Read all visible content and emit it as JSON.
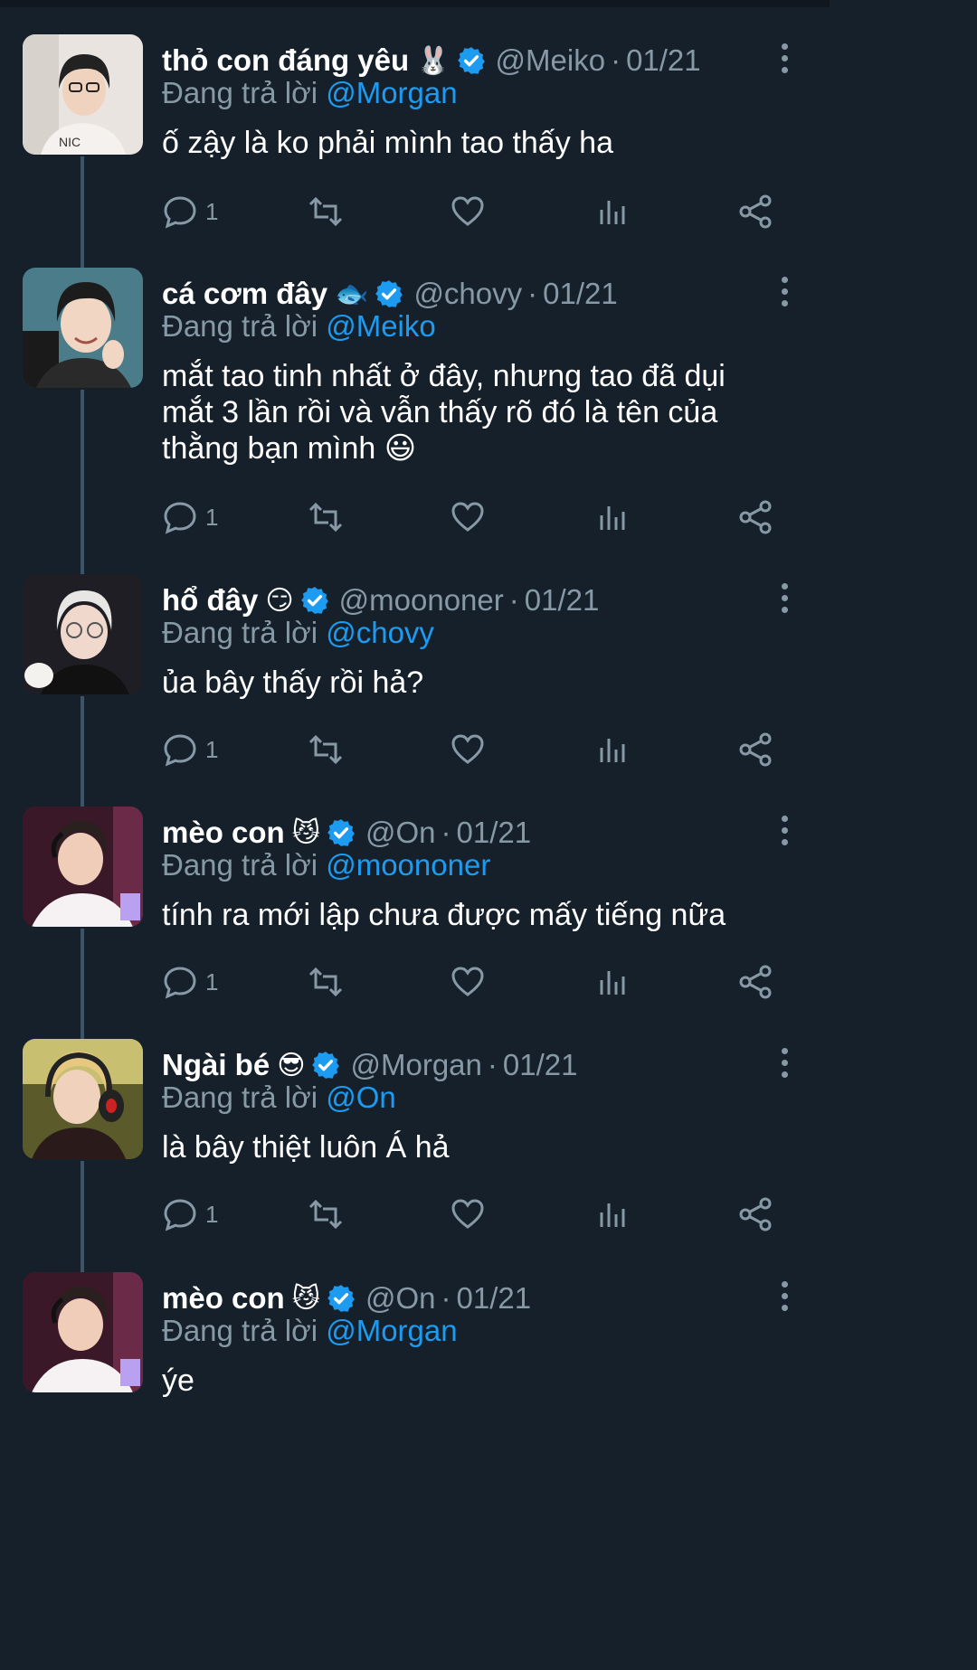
{
  "reply_prefix": "Đang trả lời",
  "tweets": [
    {
      "name": "thỏ con đáng yêu",
      "emoji": "🐰",
      "handle": "@Meiko",
      "date": "01/21",
      "reply_to": "@Morgan",
      "text": "ố zậy là ko phải mình tao thấy ha",
      "reply_count": "1"
    },
    {
      "name": "cá cơm đây",
      "emoji": "🐟",
      "handle": "@chovy",
      "date": "01/21",
      "reply_to": "@Meiko",
      "text": "mắt tao tinh nhất ở đây, nhưng tao đã dụi mắt 3 lần rồi và vẫn thấy rõ đó là tên của thằng bạn mình 😃",
      "reply_count": "1"
    },
    {
      "name": "hổ đây",
      "emoji": "😏",
      "handle": "@moononer",
      "date": "01/21",
      "reply_to": "@chovy",
      "text": "ủa bây thấy rồi hả?",
      "reply_count": "1"
    },
    {
      "name": "mèo con",
      "emoji": "😼",
      "handle": "@On",
      "date": "01/21",
      "reply_to": "@moononer",
      "text": "tính ra mới lập chưa được mấy tiếng nữa",
      "reply_count": "1"
    },
    {
      "name": "Ngài bé",
      "emoji": "😎",
      "handle": "@Morgan",
      "date": "01/21",
      "reply_to": "@On",
      "text": "là bây thiệt luôn Á hả",
      "reply_count": "1"
    },
    {
      "name": "mèo con",
      "emoji": "😼",
      "handle": "@On",
      "date": "01/21",
      "reply_to": "@Morgan",
      "text": "ýe",
      "reply_count": ""
    }
  ],
  "colors": {
    "background": "#15202b",
    "muted": "#8899a6",
    "link": "#1d9bf0",
    "verified": "#1d9bf0",
    "thread_line": "#3d5466"
  },
  "icons": {
    "reply": "reply-icon",
    "retweet": "retweet-icon",
    "like": "heart-icon",
    "stats": "stats-icon",
    "share": "share-icon",
    "more": "more-vertical-icon",
    "verified": "verified-badge-icon"
  }
}
